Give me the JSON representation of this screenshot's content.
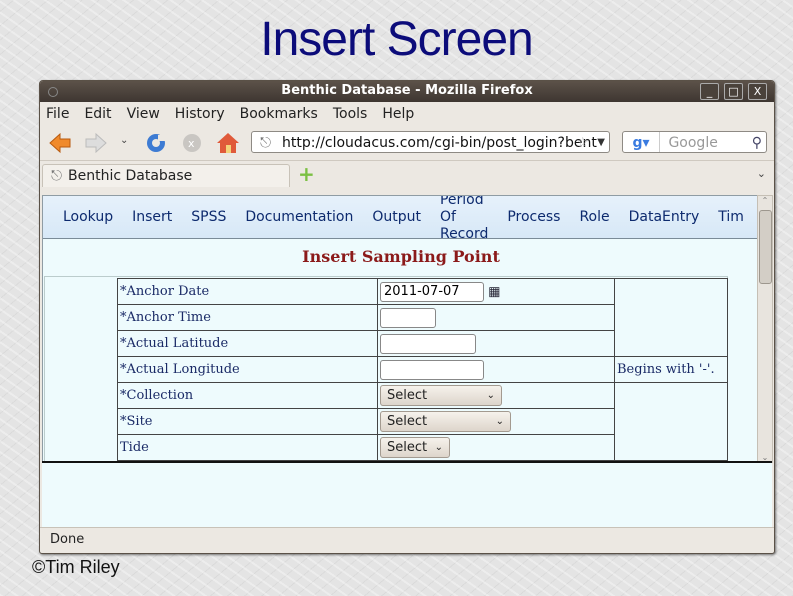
{
  "slide": {
    "title": "Insert Screen",
    "credit": "©Tim Riley"
  },
  "window": {
    "title": "Benthic Database - Mozilla Firefox",
    "controls": [
      "_",
      "□",
      "X"
    ]
  },
  "menubar": {
    "items": [
      "File",
      "Edit",
      "View",
      "History",
      "Bookmarks",
      "Tools",
      "Help"
    ]
  },
  "navbar": {
    "url": "http://cloudacus.com/cgi-bin/post_login?bent",
    "search_placeholder": "Google"
  },
  "tabs": [
    {
      "label": "Benthic Database"
    }
  ],
  "sitenav": {
    "items": [
      "Lookup",
      "Insert",
      "SPSS",
      "Documentation",
      "Output",
      "Period Of Record",
      "Process",
      "Role",
      "DataEntry",
      "Tim"
    ]
  },
  "form": {
    "heading": "Insert Sampling Point",
    "fields": [
      {
        "label": "*Anchor Date",
        "type": "date",
        "value": "2011-07-07",
        "note": ""
      },
      {
        "label": "*Anchor Time",
        "type": "text",
        "value": "",
        "note": ""
      },
      {
        "label": "*Actual Latitude",
        "type": "text",
        "value": "",
        "note": ""
      },
      {
        "label": "*Actual Longitude",
        "type": "text",
        "value": "",
        "note": "Begins with '-'."
      },
      {
        "label": "*Collection",
        "type": "select",
        "value": "Select",
        "note": ""
      },
      {
        "label": "*Site",
        "type": "select",
        "value": "Select",
        "note": ""
      },
      {
        "label": "Tide",
        "type": "select",
        "value": "Select",
        "note": ""
      }
    ]
  },
  "status": {
    "text": "Done"
  }
}
